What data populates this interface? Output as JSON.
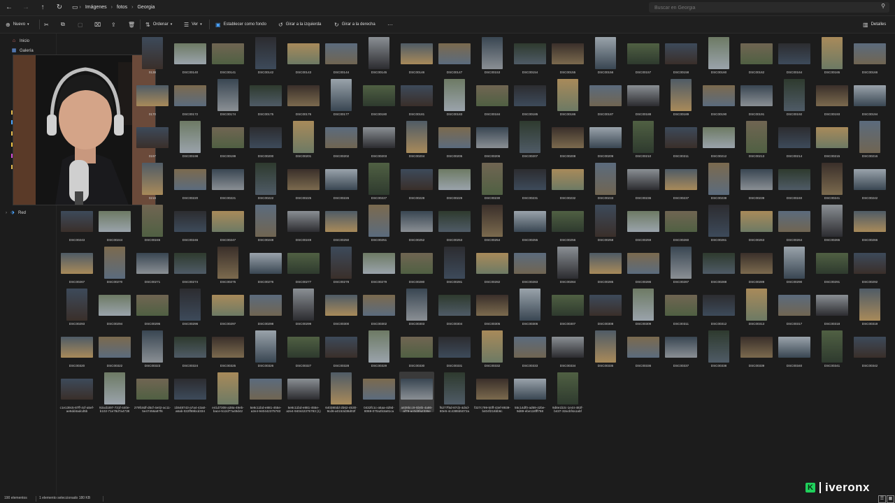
{
  "breadcrumb": {
    "items": [
      "Imágenes",
      "fotos",
      "Georgia"
    ]
  },
  "search": {
    "placeholder": "Buscar en Georgia"
  },
  "toolbar": {
    "new_label": "Nuevo",
    "sort_label": "Ordenar",
    "view_label": "Ver",
    "set_bg_label": "Establecer como fondo",
    "rotate_left_label": "Girar a la izquierda",
    "rotate_right_label": "Girar a la derecha",
    "more_label": "···",
    "details_label": "Detalles"
  },
  "sidebar": {
    "home_label": "Inicio",
    "gallery_label": "Galería",
    "network_label": "Red"
  },
  "status": {
    "count": "190 elementos",
    "selected": "1 elemento seleccionado 180 KB"
  },
  "brand": {
    "k": "K",
    "name": "iveronx"
  },
  "rows": [
    [
      "0138",
      "DSC00140",
      "DSC00141",
      "DSC00142",
      "DSC00143",
      "DSC00144",
      "DSC00145",
      "DSC00146",
      "DSC00147",
      "DSC00153",
      "DSC00154",
      "DSC00155",
      "DSC00156",
      "DSC00157",
      "DSC00158",
      "DSC00160",
      "DSC00162",
      "DSC00164",
      "DSC00165",
      "DSC00166"
    ],
    [
      "0170",
      "DSC00172",
      "DSC00174",
      "DSC00175",
      "DSC00176",
      "DSC00177",
      "DSC00180",
      "DSC00181",
      "DSC00183",
      "DSC00184",
      "DSC00185",
      "DSC00186",
      "DSC00187",
      "DSC00188",
      "DSC00189",
      "DSC00190",
      "DSC00191",
      "DSC00192",
      "DSC00193",
      "DSC00194"
    ],
    [
      "0197",
      "DSC00198",
      "DSC00199",
      "DSC00200",
      "DSC00201",
      "DSC00202",
      "DSC00203",
      "DSC00204",
      "DSC00205",
      "DSC00206",
      "DSC00207",
      "DSC00208",
      "DSC00209",
      "DSC00210",
      "DSC00211",
      "DSC00212",
      "DSC00213",
      "DSC00214",
      "DSC00215",
      "DSC00216"
    ],
    [
      "0219",
      "DSC00220",
      "DSC00221",
      "DSC00222",
      "DSC00225",
      "DSC00226",
      "DSC00227",
      "DSC00228",
      "DSC00229",
      "DSC00230",
      "DSC00231",
      "DSC00232",
      "DSC00233",
      "DSC00236",
      "DSC00237",
      "DSC00238",
      "DSC00239",
      "DSC00240",
      "DSC00241",
      "DSC00242"
    ],
    [
      "DSC00243",
      "DSC00244",
      "DSC00245",
      "DSC00246",
      "DSC00247",
      "DSC00248",
      "DSC00249",
      "DSC00250",
      "DSC00251",
      "DSC00252",
      "DSC00253",
      "DSC00254",
      "DSC00255",
      "DSC00256",
      "DSC00258",
      "DSC00259",
      "DSC00260",
      "DSC00261",
      "DSC00263",
      "DSC00264",
      "DSC00265",
      "DSC00266"
    ],
    [
      "DSC00267",
      "DSC00270",
      "DSC00271",
      "DSC00274",
      "DSC00275",
      "DSC00276",
      "DSC00277",
      "DSC00278",
      "DSC00279",
      "DSC00280",
      "DSC00281",
      "DSC00282",
      "DSC00283",
      "DSC00284",
      "DSC00285",
      "DSC00286",
      "DSC00287",
      "DSC00288",
      "DSC00289",
      "DSC00290",
      "DSC00291",
      "DSC00292"
    ],
    [
      "DSC00293",
      "DSC00294",
      "DSC00295",
      "DSC00296",
      "DSC00297",
      "DSC00298",
      "DSC00299",
      "DSC00300",
      "DSC00302",
      "DSC00303",
      "DSC00304",
      "DSC00305",
      "DSC00306",
      "DSC00307",
      "DSC00308",
      "DSC00309",
      "DSC00311",
      "DSC00312",
      "DSC00313",
      "DSC00317",
      "DSC00318",
      "DSC00319"
    ],
    [
      "DSC00320",
      "DSC00322",
      "DSC00323",
      "DSC00324",
      "DSC00325",
      "DSC00326",
      "DSC00327",
      "DSC00328",
      "DSC00329",
      "DSC00330",
      "DSC00331",
      "DSC00332",
      "DSC00333",
      "DSC00334",
      "DSC00335",
      "DSC00336",
      "DSC00337",
      "DSC00338",
      "DSC00339",
      "DSC00340",
      "DSC00341",
      "DSC00342"
    ],
    [
      "c1e139c5-87ff-4cf-a5ef-ae6dd4adcd5b",
      "92acb397-731f-440e-b102-71e78d7a4738",
      "279fc8df-d5cf-4e02-ac11-5e47456a87f6",
      "1b548743-a7a4-43a0-a6ab-022ff69bcd334",
      "e41d7308-a38a-49eb-bace-512d77a49d42",
      "5e8c11bd-e881-455e-a2e4-940442375783",
      "5e8c11bd-e881-455e-a2e4-940442375783 (1)",
      "640380dd-2b62-4530-9cd6-a0153d38d02f",
      "0432fc1c-a5aa-4d9d-8069-070a2b3a81ca",
      "a839bcc9-5b8b-4a86-af79-ac0d3fa2336e",
      "f5277f5d-87cb-4d4d-80e5-4c4385b5072a",
      "f327c799-50ff-43ef-8939-b404f216bb6c",
      "55c14df0-ad69-42be-9d89-ebe118fff758",
      "9d8e1b2c-1e44-482f-b437-32acbf4a1abf"
    ]
  ]
}
